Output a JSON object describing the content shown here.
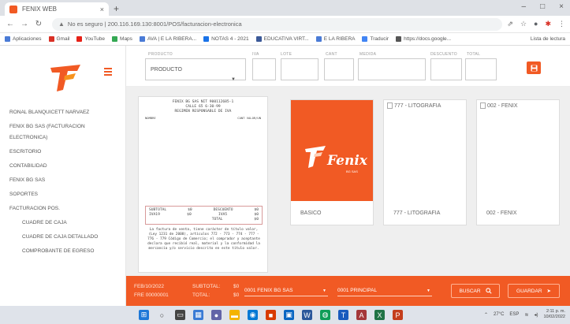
{
  "browser": {
    "tab_title": "FENIX WEB",
    "tab_close": "×",
    "new_tab": "+",
    "address_warning": "No es seguro",
    "address_url": "200.116.169.130:8001/POS/facturacion-electronica",
    "minimize": "–",
    "maximize": "□",
    "close": "×",
    "bookmarks": [
      {
        "label": "Aplicaciones",
        "color": "#4a7bd6"
      },
      {
        "label": "Gmail",
        "color": "#d93025"
      },
      {
        "label": "YouTube",
        "color": "#e62117"
      },
      {
        "label": "Maps",
        "color": "#34a853"
      },
      {
        "label": "AVA | E LA RIBERA...",
        "color": "#4a7bd6"
      },
      {
        "label": "NOTAS 4 - 2021",
        "color": "#1a73e8"
      },
      {
        "label": "EDUCATIVA VIRT...",
        "color": "#3b5998"
      },
      {
        "label": "E LA RIBERA",
        "color": "#4a7bd6"
      },
      {
        "label": "Traducir",
        "color": "#4285f4"
      },
      {
        "label": "https://docs.google...",
        "color": "#555555"
      }
    ],
    "reading_list": "Lista de lectura"
  },
  "sidebar": {
    "menu": [
      {
        "label": "RONAL BLANQUICETT NARVAEZ",
        "sub": false
      },
      {
        "label": "FENIX BG SAS (FACTURACION",
        "sub": false
      },
      {
        "label": "ELECTRONICA)",
        "sub": false
      },
      {
        "label": "ESCRITORIO",
        "sub": false
      },
      {
        "label": "CONTABILIDAD",
        "sub": false
      },
      {
        "label": "FENIX BG SAS",
        "sub": false
      },
      {
        "label": "SOPORTES",
        "sub": false
      },
      {
        "label": "FACTURACION POS.",
        "sub": false
      },
      {
        "label": "CUADRE DE CAJA",
        "sub": true
      },
      {
        "label": "CUADRE DE CAJA DETALLADO",
        "sub": true
      },
      {
        "label": "COMPROBANTE DE EGRESO",
        "sub": true
      }
    ]
  },
  "form": {
    "labels": {
      "producto": "PRODUCTO",
      "iva": "IVA",
      "lote": "LOTE",
      "cant": "CANT",
      "medida": "MEDIDA",
      "descuento": "DESCUENTO",
      "total": "TOTAL"
    },
    "producto_value": "PRODUCTO",
    "dropdown_arrow": "▼",
    "save_icon": "floppy-icon"
  },
  "receipt": {
    "header_lines": [
      "FENIX BG SAS NIT 900112685-1",
      "CALLE 65 6-30-99",
      "REGIMEN RESPONSABLE DE IVA"
    ],
    "col_left": "NOMBRE",
    "col_right": "CANT  VALOR/UN",
    "totals": [
      {
        "l1": "SUBTOTAL",
        "v1": "$0",
        "l2": "DESCUENTO",
        "v2": "$0"
      },
      {
        "l1": "IVA19",
        "v1": "$0",
        "l2": "IVA5",
        "v2": "$0"
      },
      {
        "l1": "",
        "v1": "",
        "l2": "TOTAL",
        "v2": "$0"
      }
    ],
    "legal": "La factura de venta, tiene carácter de título valor, (Ley 1231 de 2008), artículos 772 - 773 - 774 - 777 - 776 - 779 Código de Comercio; el comprador y aceptante declara que recibió real, material y la conformidad la mercancía y/o servicio descrito en este título valor."
  },
  "cards": [
    {
      "caption": "BASICO",
      "alt": "",
      "logo_text": "Fenix",
      "logo_sub": "BG SAS"
    },
    {
      "caption": "777 - LITOGRAFIA",
      "alt": "777 - LITOGRAFIA"
    },
    {
      "caption": "002 - FENIX",
      "alt": "002 - FENIX"
    }
  ],
  "footer": {
    "date_line": "FEB/10/2022",
    "invoice_line": "FRE 00000001",
    "subtotal_label": "SUBTOTAL:",
    "subtotal_value": "$0",
    "total_label": "TOTAL:",
    "total_value": "$0",
    "company_select": "0001 FENIX BG SAS",
    "warehouse_select": "0001 PRINCIPAL",
    "buscar": "BUSCAR",
    "guardar": "GUARDAR"
  },
  "taskbar": {
    "temp": "27°C",
    "lang": "ESP",
    "time": "2:11 p. m.",
    "date": "10/02/2022"
  },
  "colors": {
    "brand": "#f15a24"
  }
}
